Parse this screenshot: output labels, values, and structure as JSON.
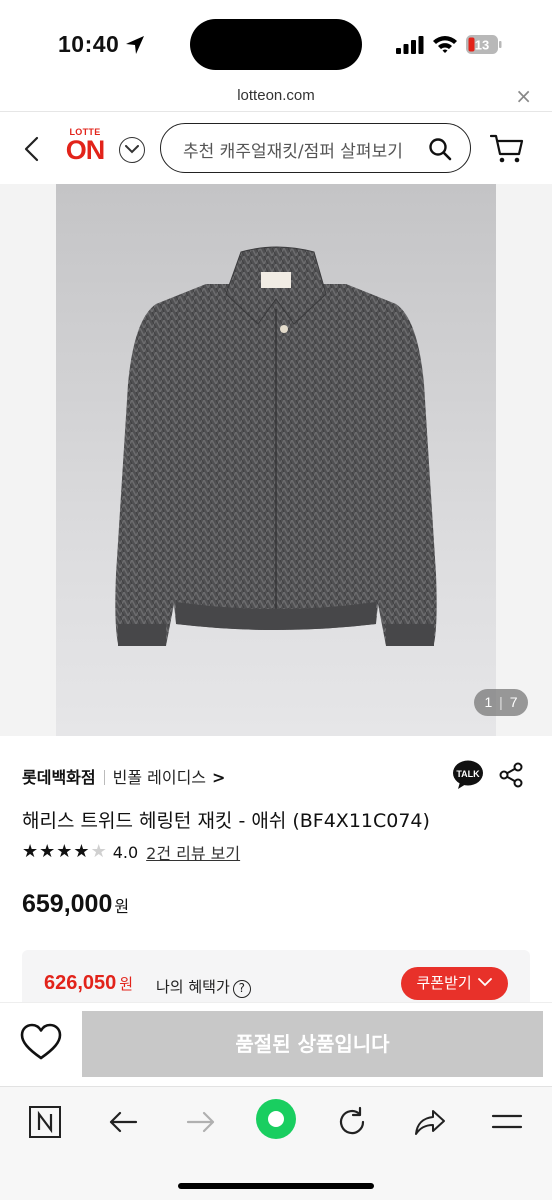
{
  "status_bar": {
    "time": "10:40",
    "battery": "13"
  },
  "url_bar": {
    "url": "lotteon.com",
    "close_icon": "×"
  },
  "header": {
    "logo_top": "LOTTE",
    "logo_main": "ON",
    "search_placeholder": "추천 캐주얼재킷/점퍼 살펴보기"
  },
  "gallery": {
    "counter_current": "1",
    "counter_total": "7"
  },
  "product": {
    "store": "롯데백화점",
    "brand": "빈폴 레이디스",
    "brand_chevron": ">",
    "talk_label": "TALK",
    "title": "해리스 트위드 헤링턴 재킷 - 애쉬 (BF4X11C074)",
    "rating": {
      "stars_filled": 4,
      "stars_total": 5,
      "score": "4.0",
      "review_link": "2건 리뷰 보기"
    },
    "price": "659,000",
    "price_unit": "원"
  },
  "benefit": {
    "price": "626,050",
    "unit": "원",
    "label": "나의 혜택가",
    "help": "?",
    "coupon_button": "쿠폰받기"
  },
  "buy_bar": {
    "soldout_label": "품절된 상품입니다"
  },
  "colors": {
    "brand_red": "#e2231a",
    "coupon_red": "#e8312a",
    "soldout_gray": "#c8c8c8",
    "naver_green": "#19ce60"
  }
}
